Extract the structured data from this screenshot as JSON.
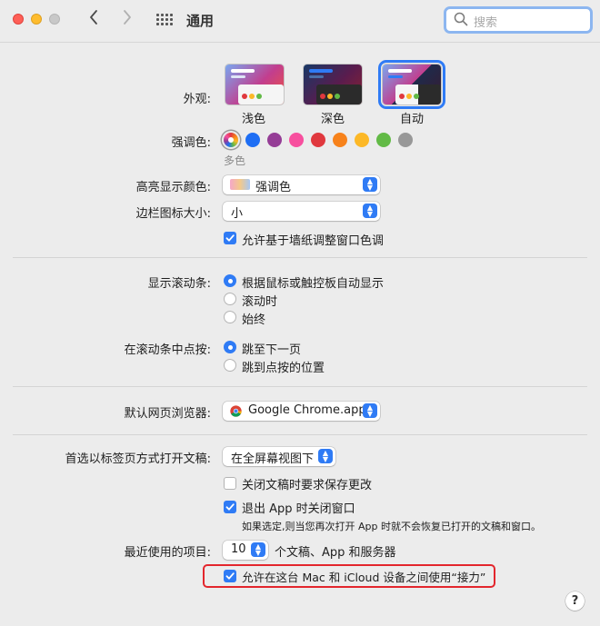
{
  "window": {
    "title": "通用",
    "search_placeholder": "搜索"
  },
  "appearance": {
    "label": "外观:",
    "options": [
      {
        "name": "浅色",
        "selected": false
      },
      {
        "name": "深色",
        "selected": false
      },
      {
        "name": "自动",
        "selected": true
      }
    ]
  },
  "accent": {
    "label": "强调色:",
    "selected_name": "多色",
    "colors": [
      "multicolor",
      "#1e6ef4",
      "#953d96",
      "#f74f9e",
      "#e0383e",
      "#f7821b",
      "#fcb827",
      "#62ba46",
      "#989898"
    ]
  },
  "highlight": {
    "label": "高亮显示颜色:",
    "value": "强调色"
  },
  "sidebar_icon": {
    "label": "边栏图标大小:",
    "value": "小"
  },
  "wallpaper_tint": {
    "label": "允许基于墙纸调整窗口色调",
    "checked": true
  },
  "scrollbars": {
    "label": "显示滚动条:",
    "options": [
      "根据鼠标或触控板自动显示",
      "滚动时",
      "始终"
    ],
    "selected_index": 0
  },
  "scroll_click": {
    "label": "在滚动条中点按:",
    "options": [
      "跳至下一页",
      "跳到点按的位置"
    ],
    "selected_index": 0
  },
  "browser": {
    "label": "默认网页浏览器:",
    "value": "Google Chrome.app"
  },
  "tabs": {
    "label": "首选以标签页方式打开文稿:",
    "value": "在全屏幕视图下"
  },
  "ask_save": {
    "label": "关闭文稿时要求保存更改",
    "checked": false
  },
  "close_windows": {
    "label": "退出 App 时关闭窗口",
    "checked": true,
    "note": "如果选定,则当您再次打开 App 时就不会恢复已打开的文稿和窗口。"
  },
  "recent": {
    "label": "最近使用的项目:",
    "value": "10",
    "suffix": "个文稿、App 和服务器"
  },
  "handoff": {
    "label": "允许在这台 Mac 和 iCloud 设备之间使用“接力”",
    "checked": true
  },
  "help": {
    "label": "?"
  }
}
